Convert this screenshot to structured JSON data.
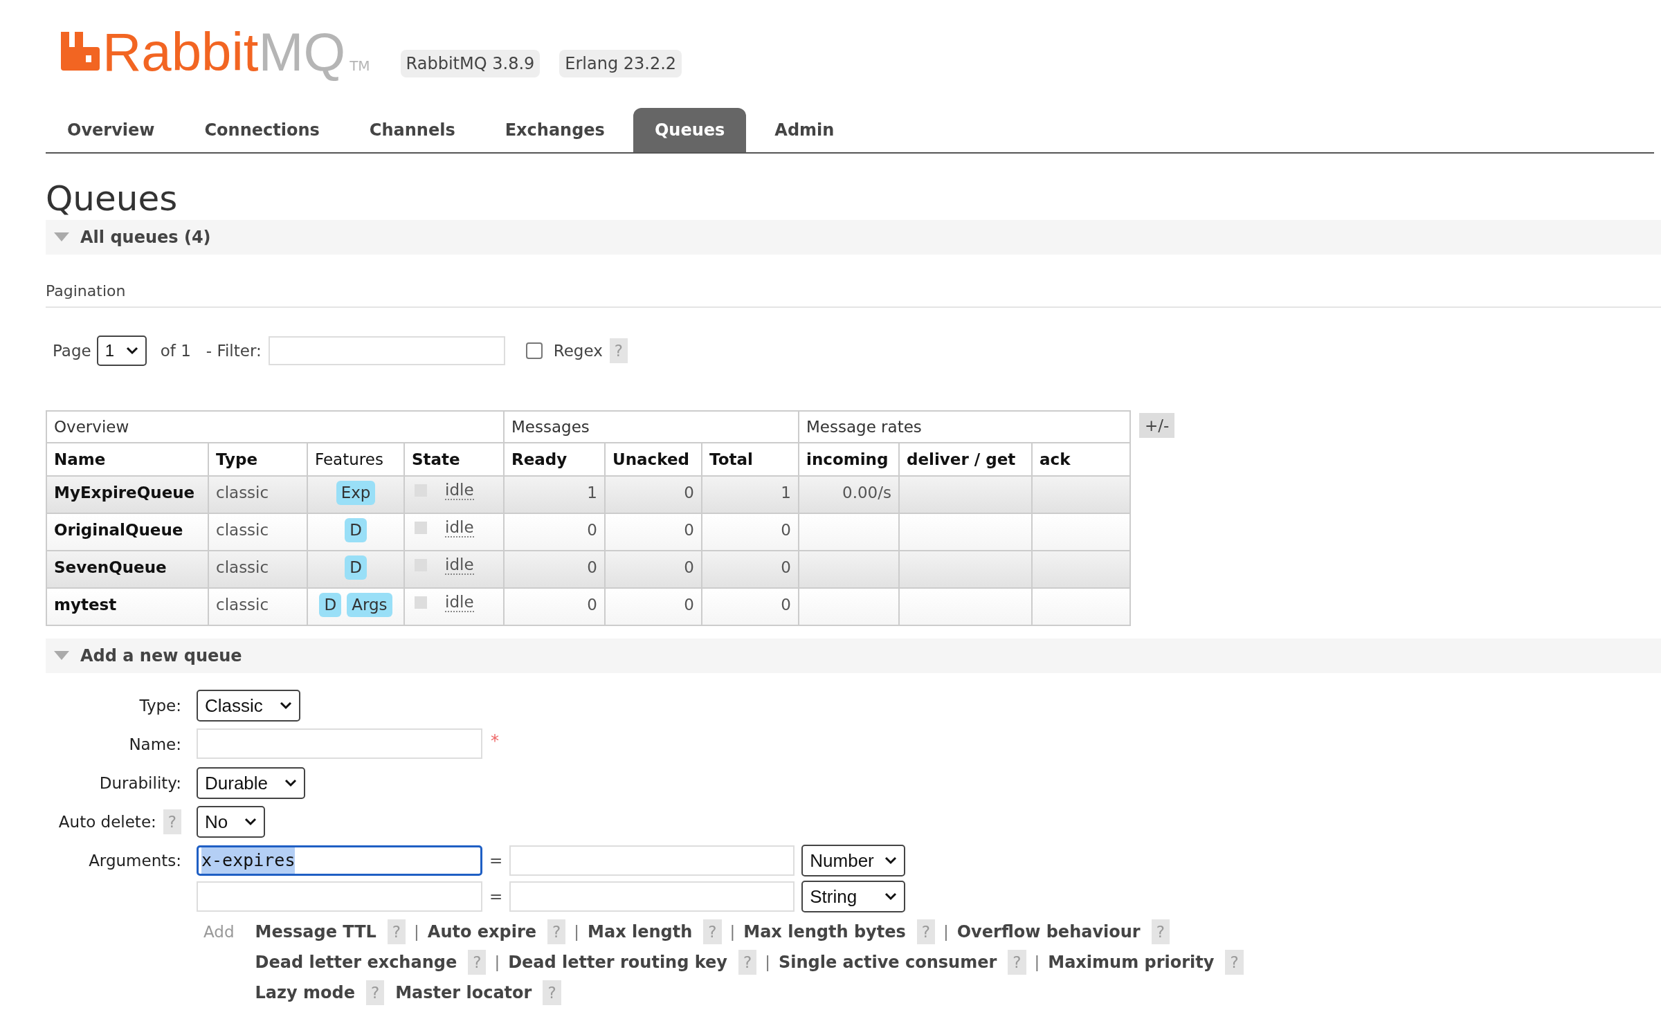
{
  "header": {
    "logo": {
      "brand_a": "Rabbit",
      "brand_b": "MQ",
      "trademark": "TM"
    },
    "badges": [
      "RabbitMQ 3.8.9",
      "Erlang 23.2.2"
    ]
  },
  "tabs": [
    {
      "label": "Overview",
      "selected": false
    },
    {
      "label": "Connections",
      "selected": false
    },
    {
      "label": "Channels",
      "selected": false
    },
    {
      "label": "Exchanges",
      "selected": false
    },
    {
      "label": "Queues",
      "selected": true
    },
    {
      "label": "Admin",
      "selected": false
    }
  ],
  "page_title": "Queues",
  "all_queues": {
    "title": "All queues (4)",
    "expanded": true,
    "pagination": {
      "heading": "Pagination",
      "page_label": "Page",
      "page_value": "1",
      "of_label": "of 1",
      "filter_label": "- Filter:",
      "regex": {
        "label": "Regex",
        "checked": false,
        "help": "?"
      }
    },
    "table": {
      "group_headers": [
        {
          "label": "Overview"
        },
        {
          "label": "Messages"
        },
        {
          "label": "Message rates"
        }
      ],
      "columns": [
        {
          "label": "Name",
          "sortable": true
        },
        {
          "label": "Type",
          "sortable": true
        },
        {
          "label": "Features",
          "sortable": false
        },
        {
          "label": "State",
          "sortable": true
        },
        {
          "label": "Ready",
          "sortable": true
        },
        {
          "label": "Unacked",
          "sortable": true
        },
        {
          "label": "Total",
          "sortable": true
        },
        {
          "label": "incoming",
          "sortable": true
        },
        {
          "label": "deliver / get",
          "sortable": true
        },
        {
          "label": "ack",
          "sortable": true
        }
      ],
      "rows": [
        {
          "name": "MyExpireQueue",
          "type": "classic",
          "features": [
            "Exp"
          ],
          "state": "idle",
          "ready": "1",
          "unacked": "0",
          "total": "1",
          "incoming": "0.00/s"
        },
        {
          "name": "OriginalQueue",
          "type": "classic",
          "features": [
            "D"
          ],
          "state": "idle",
          "ready": "0",
          "unacked": "0",
          "total": "0"
        },
        {
          "name": "SevenQueue",
          "type": "classic",
          "features": [
            "D"
          ],
          "state": "idle",
          "ready": "0",
          "unacked": "0",
          "total": "0"
        },
        {
          "name": "mytest",
          "type": "classic",
          "features": [
            "D",
            "Args"
          ],
          "state": "idle",
          "ready": "0",
          "unacked": "0",
          "total": "0"
        }
      ],
      "columns_toggle": "+/-"
    }
  },
  "add_queue": {
    "title": "Add a new queue",
    "expanded": true,
    "fields": [
      {
        "kind": "select",
        "label": "Type:",
        "value": "Classic"
      },
      {
        "kind": "text",
        "label": "Name:",
        "required_mark": "*"
      },
      {
        "kind": "select",
        "label": "Durability:",
        "value": "Durable"
      },
      {
        "kind": "select",
        "label": "Auto delete:",
        "help": "?",
        "value": "No"
      },
      {
        "kind": "arguments",
        "label": "Arguments:",
        "rows": [
          {
            "key": "x-expires",
            "key_highlighted": true,
            "focused": true,
            "equals": "=",
            "type": "Number"
          },
          {
            "focused": false,
            "equals": "=",
            "type": "String"
          }
        ]
      }
    ],
    "add_label": "Add",
    "shortcut_lines": [
      [
        {
          "label": "Message TTL",
          "help": "?",
          "separator": "|"
        },
        {
          "label": "Auto expire",
          "help": "?",
          "separator": "|"
        },
        {
          "label": "Max length",
          "help": "?",
          "separator": "|"
        },
        {
          "label": "Max length bytes",
          "help": "?",
          "separator": "|"
        },
        {
          "label": "Overflow behaviour",
          "help": "?"
        }
      ],
      [
        {
          "label": "Dead letter exchange",
          "help": "?",
          "separator": "|"
        },
        {
          "label": "Dead letter routing key",
          "help": "?",
          "separator": "|"
        },
        {
          "label": "Single active consumer",
          "help": "?",
          "separator": "|"
        },
        {
          "label": "Maximum priority",
          "help": "?"
        }
      ],
      [
        {
          "label": "Lazy mode",
          "help": "?"
        },
        {
          "label": "Master locator",
          "help": "?"
        }
      ]
    ]
  }
}
